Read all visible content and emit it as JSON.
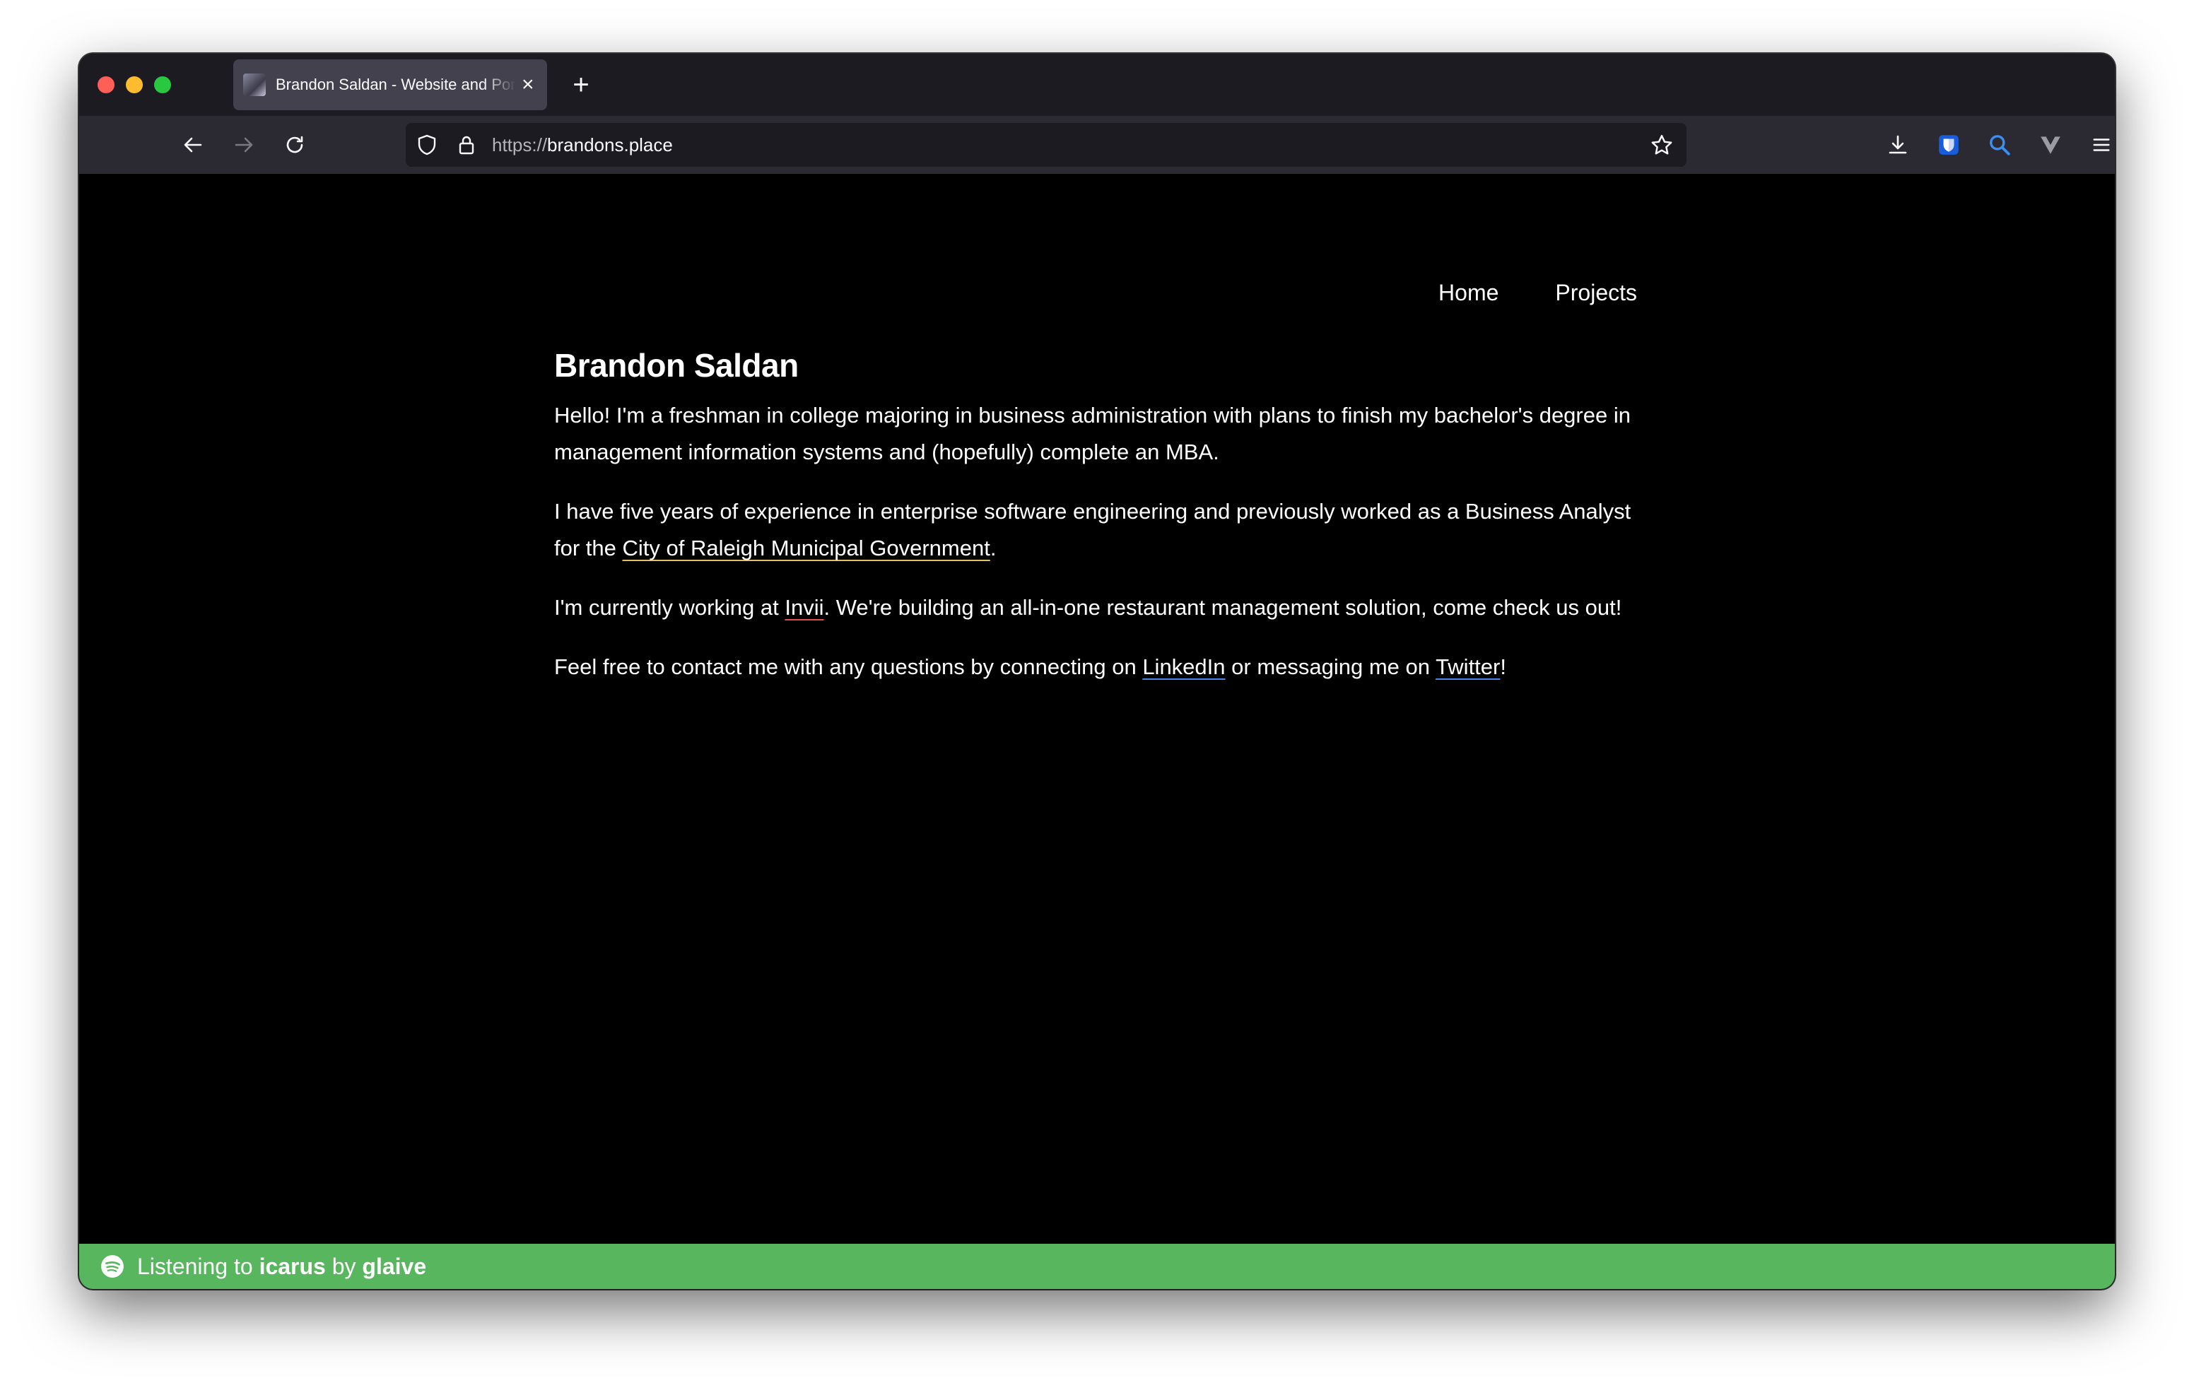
{
  "browser": {
    "tab_title": "Brandon Saldan - Website and Portfolio",
    "close_glyph": "×",
    "new_tab_glyph": "+",
    "url_scheme": "https://",
    "url_host": "brandons.place"
  },
  "site": {
    "nav": [
      "Home",
      "Projects"
    ],
    "heading": "Brandon Saldan",
    "p1": "Hello! I'm a freshman in college majoring in business administration with plans to finish my bachelor's degree in management information systems and (hopefully) complete an MBA.",
    "p2_before": "I have five years of experience in enterprise software engineering and previously worked as a Business Analyst for the ",
    "p2_link": "City of Raleigh Municipal Government",
    "p2_after": ".",
    "p3_before": "I'm currently working at ",
    "p3_link": "Invii",
    "p3_after": ". We're building an all-in-one restaurant management solution, come check us out!",
    "p4_before": "Feel free to contact me with any questions by connecting on ",
    "p4_link1": "LinkedIn",
    "p4_middle": " or messaging me on ",
    "p4_link2": "Twitter",
    "p4_after": "!"
  },
  "spotify": {
    "prefix": "Listening to ",
    "track": "icarus",
    "by": " by ",
    "artist": "glaive"
  },
  "colors": {
    "spotify_green": "#58b65f",
    "bitwarden_blue": "#175ddc",
    "search_blue": "#3d8ef0"
  }
}
